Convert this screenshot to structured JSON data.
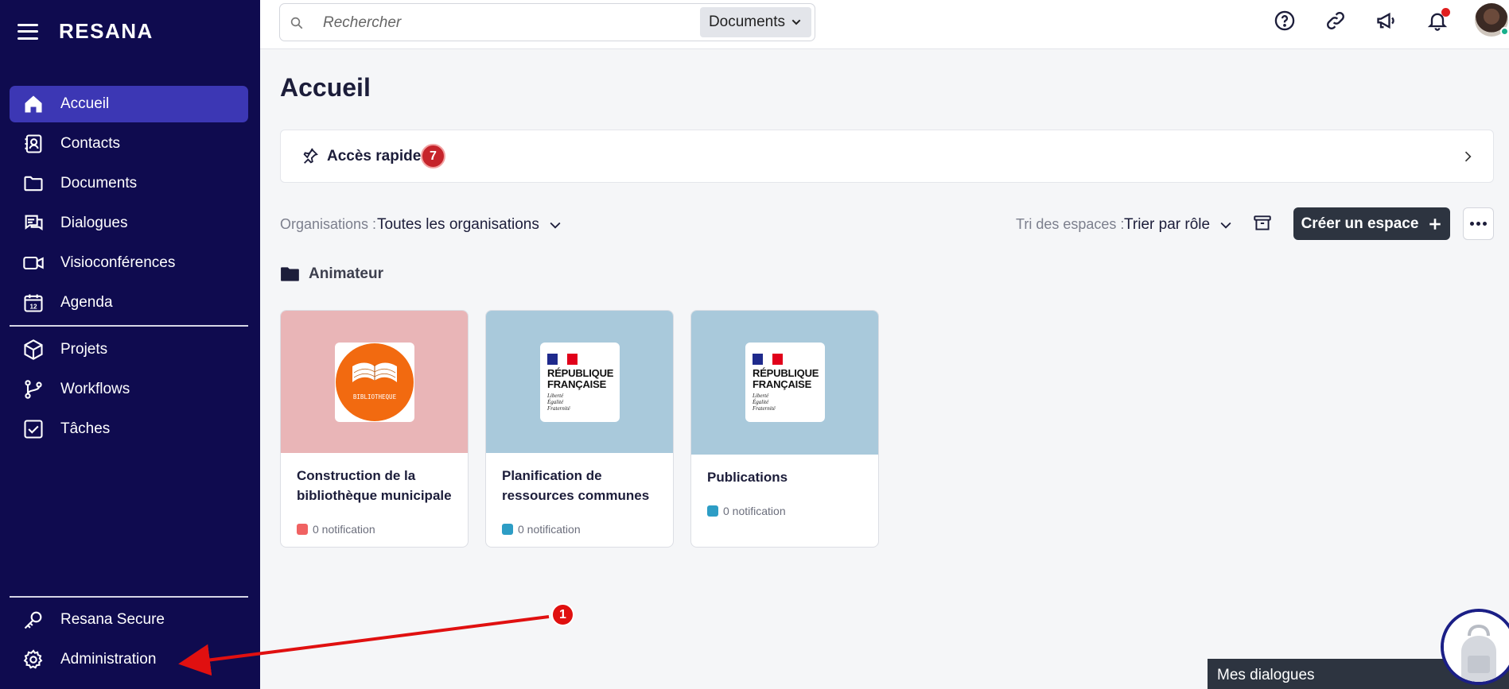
{
  "app": {
    "brand": "RESANA"
  },
  "sidebar": {
    "items": [
      {
        "label": "Accueil"
      },
      {
        "label": "Contacts"
      },
      {
        "label": "Documents"
      },
      {
        "label": "Dialogues"
      },
      {
        "label": "Visioconférences"
      },
      {
        "label": "Agenda"
      },
      {
        "label": "Projets"
      },
      {
        "label": "Workflows"
      },
      {
        "label": "Tâches"
      },
      {
        "label": "Resana Secure"
      },
      {
        "label": "Administration"
      }
    ]
  },
  "topbar": {
    "search_placeholder": "Rechercher",
    "search_scope": "Documents",
    "icons": [
      "help-icon",
      "link-icon",
      "megaphone-icon",
      "bell-icon",
      "avatar"
    ]
  },
  "main": {
    "title": "Accueil",
    "quick_access": {
      "label": "Accès rapide",
      "count": "7"
    },
    "filters": {
      "org_label": "Organisations :",
      "org_value": "Toutes les organisations",
      "sort_label": "Tri des espaces :",
      "sort_value": "Trier par rôle"
    },
    "create_label": "Créer un espace",
    "section": "Animateur",
    "cards": [
      {
        "title": "Construction de la bibliothèque municipale",
        "notif": "0 notification",
        "color": "#f06262",
        "bg": "#e9b5b7",
        "logo": "BIBLIOTHEQUE"
      },
      {
        "title": "Planification de ressources communes",
        "notif": "0 notification",
        "color": "#2d9dc5",
        "bg": "#a9c9db",
        "logo": "rf"
      },
      {
        "title": "Publications",
        "notif": "0 notification",
        "color": "#2d9dc5",
        "bg": "#a9c9db",
        "logo": "rf"
      }
    ],
    "rf_logo": {
      "line1": "RÉPUBLIQUE",
      "line2": "FRANÇAISE",
      "motto1": "Liberté",
      "motto2": "Égalité",
      "motto3": "Fraternité"
    }
  },
  "annotation": {
    "number": "1"
  },
  "footer": {
    "dialogs_label": "Mes dialogues"
  },
  "colors": {
    "sidebar": "#0f0b4f",
    "active": "#3c37b4",
    "accent_dark": "#2d3440",
    "badge": "#c6242b"
  }
}
